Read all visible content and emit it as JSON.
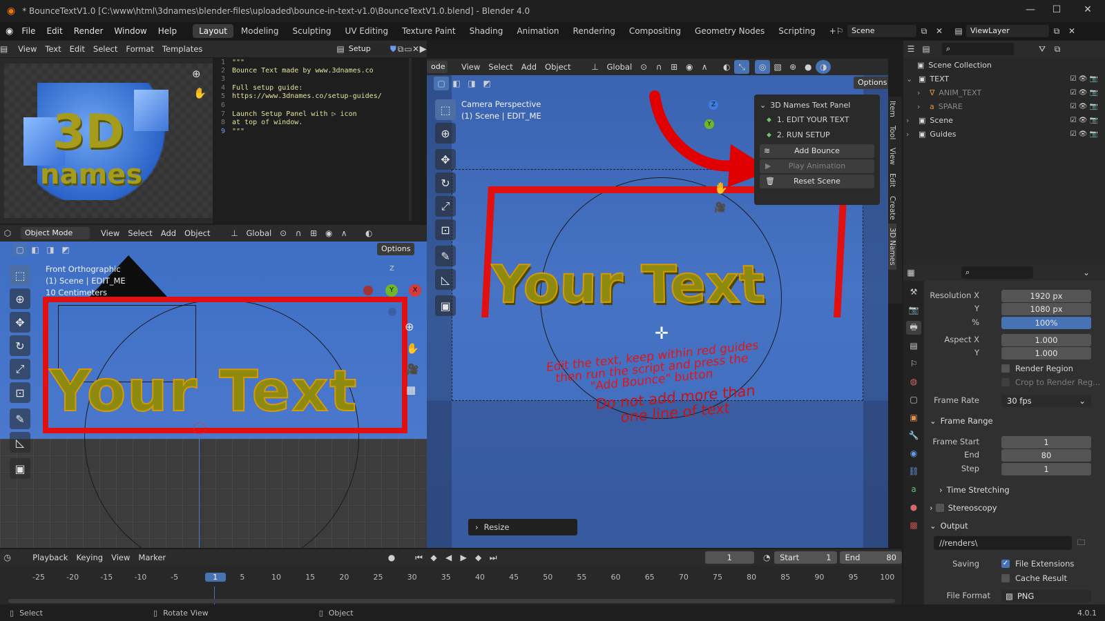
{
  "window": {
    "title": "* BounceTextV1.0 [C:\\www\\html\\3dnames\\blender-files\\uploaded\\bounce-in-text-v1.0\\BounceTextV1.0.blend] - Blender 4.0",
    "minimize": "—",
    "maximize": "☐",
    "close": "✕"
  },
  "menu": {
    "items": [
      "File",
      "Edit",
      "Render",
      "Window",
      "Help"
    ],
    "workspaces": [
      "Layout",
      "Modeling",
      "Sculpting",
      "UV Editing",
      "Texture Paint",
      "Shading",
      "Animation",
      "Rendering",
      "Compositing",
      "Geometry Nodes",
      "Scripting"
    ],
    "add_tab": "+",
    "scene_name": "Scene",
    "view_layer": "ViewLayer"
  },
  "text_editor": {
    "menus": [
      "View",
      "Text",
      "Edit",
      "Select",
      "Format",
      "Templates"
    ],
    "file_name": "Setup Panel",
    "lines": [
      {
        "n": "1",
        "t": "\"\"\""
      },
      {
        "n": "2",
        "t": "Bounce Text made by www.3dnames.co"
      },
      {
        "n": "3",
        "t": ""
      },
      {
        "n": "4",
        "t": "Full setup guide:"
      },
      {
        "n": "5",
        "t": "https://www.3dnames.co/setup-guides/"
      },
      {
        "n": "6",
        "t": ""
      },
      {
        "n": "7",
        "t": "Launch Setup Panel with ▷ icon"
      },
      {
        "n": "8",
        "t": "at top of window."
      },
      {
        "n": "9",
        "t": "\"\"\""
      }
    ]
  },
  "logo": {
    "line1": "3D",
    "line2": "names"
  },
  "front_view": {
    "mode": "Object Mode",
    "menus": [
      "View",
      "Select",
      "Add",
      "Object"
    ],
    "orientation": "Global",
    "options": "Options",
    "overlay_title": "Front Orthographic",
    "overlay_scene": "(1) Scene | EDIT_ME",
    "overlay_scale": "10 Centimeters",
    "text": "Your Text",
    "axis_z": "Z",
    "axis_y": "Y",
    "axis_x": "X"
  },
  "camera_view": {
    "mode_partial": "ode",
    "menus": [
      "View",
      "Select",
      "Add",
      "Object"
    ],
    "orientation": "Global",
    "options": "Options",
    "overlay_title": "Camera Perspective",
    "overlay_scene": "(1) Scene | EDIT_ME",
    "text": "Your Text",
    "note1_line1": "Edit the text, keep within red guides",
    "note1_line2": "then run the script and press the",
    "note1_line3": "\"Add Bounce\" button",
    "note2_line1": "Do not add more than",
    "note2_line2": "one line of text",
    "resize_label": "Resize",
    "axis_z": "Z",
    "axis_y": "Y"
  },
  "names_panel": {
    "title": "3D Names Text Panel",
    "step1": "1. EDIT YOUR TEXT",
    "step2": "2. RUN SETUP",
    "add_bounce": "Add Bounce",
    "play_animation": "Play Animation",
    "reset_scene": "Reset Scene"
  },
  "sidebar_tabs": [
    "Item",
    "Tool",
    "View",
    "Edit",
    "Create",
    "3D Names"
  ],
  "outliner": {
    "root": "Scene Collection",
    "items": [
      {
        "label": "TEXT",
        "indent": 1,
        "dim": false
      },
      {
        "label": "ANIM_TEXT",
        "indent": 2,
        "dim": true
      },
      {
        "label": "SPARE",
        "indent": 2,
        "dim": true
      },
      {
        "label": "Scene",
        "indent": 1,
        "dim": false
      },
      {
        "label": "Guides",
        "indent": 1,
        "dim": false
      }
    ]
  },
  "properties": {
    "res_x_label": "Resolution X",
    "res_x": "1920 px",
    "res_y_label": "Y",
    "res_y": "1080 px",
    "pct_label": "%",
    "pct": "100%",
    "aspect_x_label": "Aspect X",
    "aspect_x": "1.000",
    "aspect_y_label": "Y",
    "aspect_y": "1.000",
    "render_region": "Render Region",
    "crop": "Crop to Render Reg...",
    "frame_rate_label": "Frame Rate",
    "frame_rate": "30 fps",
    "frame_range": "Frame Range",
    "frame_start_label": "Frame Start",
    "frame_start": "1",
    "end_label": "End",
    "end": "80",
    "step_label": "Step",
    "step": "1",
    "time_stretching": "Time Stretching",
    "stereoscopy": "Stereoscopy",
    "output": "Output",
    "output_path": "//renders\\",
    "saving_label": "Saving",
    "file_extensions": "File Extensions",
    "cache_result": "Cache Result",
    "file_format_label": "File Format",
    "file_format": "PNG"
  },
  "timeline": {
    "menus": [
      "Playback",
      "Keying",
      "View",
      "Marker"
    ],
    "current_frame": "1",
    "start_label": "Start",
    "start": "1",
    "end_label": "End",
    "end": "80",
    "ticks": [
      "-25",
      "-20",
      "-15",
      "-10",
      "-5",
      "1",
      "5",
      "10",
      "15",
      "20",
      "25",
      "30",
      "35",
      "40",
      "45",
      "50",
      "55",
      "60",
      "65",
      "70",
      "75",
      "80",
      "85",
      "90",
      "95",
      "100"
    ]
  },
  "status": {
    "select": "Select",
    "rotate": "Rotate View",
    "object": "Object",
    "version": "4.0.1"
  },
  "colors": {
    "accent": "#4772b3",
    "viewport_blue": "#3e6fc5",
    "guide_red": "#e01010",
    "text_gold": "#8e8a10"
  }
}
